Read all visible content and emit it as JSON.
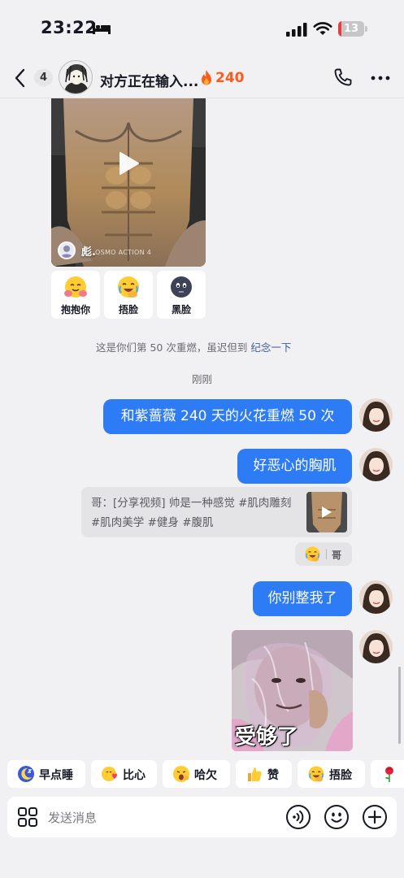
{
  "status_bar": {
    "time": "23:22",
    "battery": "13",
    "battery_level": 0.13
  },
  "header": {
    "unread_count": "4",
    "title": "对方正在输入...",
    "spark_count": "240"
  },
  "video_card": {
    "author": "彪.",
    "watermark": "OSMO ACTION 4"
  },
  "quick_stickers": [
    {
      "label": "抱抱你",
      "icon": "hug-emoji-icon"
    },
    {
      "label": "捂脸",
      "icon": "facepalm-emoji-icon"
    },
    {
      "label": "黑脸",
      "icon": "dark-face-emoji-icon"
    }
  ],
  "system_message": {
    "text": "这是你们第 50 次重燃，虽迟但到",
    "link": "纪念一下"
  },
  "timestamp": "刚刚",
  "messages": {
    "m1": "和紫蔷薇 240 天的火花重燃 50 次",
    "m2": "好恶心的胸肌",
    "m3": "你别整我了"
  },
  "quote": {
    "text": "哥：[分享视频] 帅是一种感觉 #肌肉雕刻 #肌肉美学 #健身 #腹肌"
  },
  "reaction": {
    "emoji": "facepalm-emoji-icon",
    "user": "哥"
  },
  "sticker_caption": "受够了",
  "quick_replies": [
    {
      "label": "早点睡",
      "icon": "moon-sleep-icon"
    },
    {
      "label": "比心",
      "icon": "heart-hands-icon"
    },
    {
      "label": "哈欠",
      "icon": "yawn-emoji-icon"
    },
    {
      "label": "赞",
      "icon": "thumbs-up-icon"
    },
    {
      "label": "捂脸",
      "icon": "facepalm-emoji-icon"
    },
    {
      "label": "",
      "icon": "rose-icon"
    }
  ],
  "input": {
    "placeholder": "发送消息"
  },
  "colors": {
    "accent": "#2e7bf6",
    "spark": "#fe5a1d",
    "background": "#f1f1f3"
  }
}
